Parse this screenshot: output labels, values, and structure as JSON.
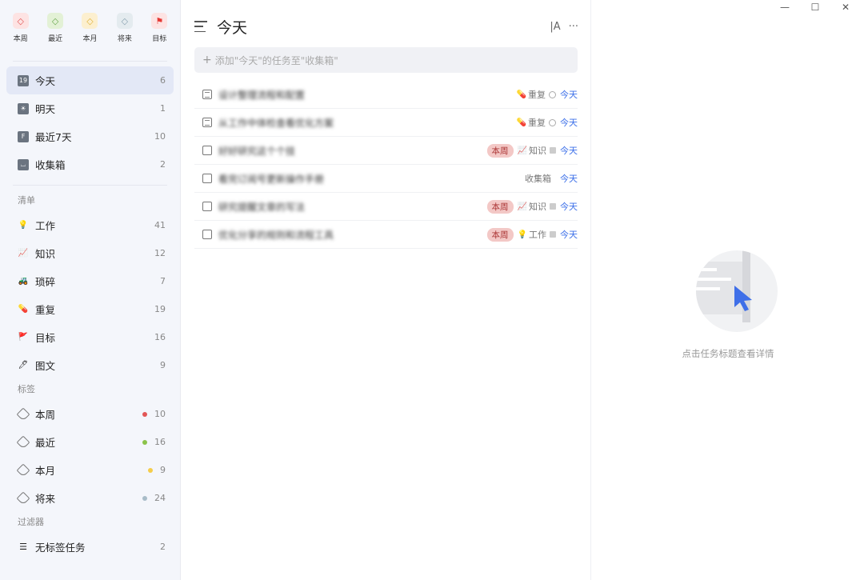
{
  "quick_filters": [
    {
      "label": "本周",
      "icon": "tag-red-icon",
      "bg": "#fde3e3",
      "color": "#e25656"
    },
    {
      "label": "最近",
      "icon": "tag-green-icon",
      "bg": "#e3f1d6",
      "color": "#6aa84f"
    },
    {
      "label": "本月",
      "icon": "tag-yellow-icon",
      "bg": "#fcefcf",
      "color": "#e0b33b"
    },
    {
      "label": "将来",
      "icon": "tag-gray-icon",
      "bg": "#e4ebef",
      "color": "#8aa2b1"
    },
    {
      "label": "目标",
      "icon": "flag-icon",
      "bg": "#fde3e3",
      "color": "#e53935"
    }
  ],
  "smart_lists": [
    {
      "label": "今天",
      "count": "6",
      "icon": "calendar-today-icon",
      "glyph": "19"
    },
    {
      "label": "明天",
      "count": "1",
      "icon": "sunrise-icon",
      "glyph": "☀"
    },
    {
      "label": "最近7天",
      "count": "10",
      "icon": "calendar-week-icon",
      "glyph": "F"
    },
    {
      "label": "收集箱",
      "count": "2",
      "icon": "inbox-icon",
      "glyph": "⌴"
    }
  ],
  "lists_title": "清单",
  "lists": [
    {
      "label": "工作",
      "count": "41",
      "icon": "lightbulb-icon",
      "glyph": "💡"
    },
    {
      "label": "知识",
      "count": "12",
      "icon": "knowledge-icon",
      "glyph": "📈"
    },
    {
      "label": "琐碎",
      "count": "7",
      "icon": "tractor-icon",
      "glyph": "🚜"
    },
    {
      "label": "重复",
      "count": "19",
      "icon": "pill-icon",
      "glyph": "💊"
    },
    {
      "label": "目标",
      "count": "16",
      "icon": "flag-icon",
      "glyph": "🚩"
    },
    {
      "label": "图文",
      "count": "9",
      "icon": "pen-icon",
      "glyph": "🖊"
    }
  ],
  "tags_title": "标签",
  "tags": [
    {
      "label": "本周",
      "count": "10",
      "color": "#e25656"
    },
    {
      "label": "最近",
      "count": "16",
      "color": "#8bc34a"
    },
    {
      "label": "本月",
      "count": "9",
      "color": "#f5cd4a"
    },
    {
      "label": "将来",
      "count": "24",
      "color": "#a8bcc8"
    }
  ],
  "filters_title": "过滤器",
  "filters": [
    {
      "label": "无标签任务",
      "count": "2"
    }
  ],
  "main": {
    "title": "今天",
    "sort_label": "|A",
    "more_label": "···",
    "add_placeholder": "添加\"今天\"的任务至\"收集箱\""
  },
  "tasks": [
    {
      "title": "设计整理流程和配置",
      "type": "note",
      "tag": "",
      "list": "重复",
      "list_glyph": "💊",
      "marker": "circle",
      "date": "今天"
    },
    {
      "title": "从工作中体检查看优化方案",
      "type": "note",
      "tag": "",
      "list": "重复",
      "list_glyph": "💊",
      "marker": "circle",
      "date": "今天"
    },
    {
      "title": "好好研究这个个技",
      "type": "check",
      "tag": "本周",
      "list": "知识",
      "list_glyph": "📈",
      "marker": "square",
      "date": "今天"
    },
    {
      "title": "看完订阅号更新操作手册",
      "type": "check",
      "tag": "",
      "list": "收集箱",
      "list_glyph": "",
      "marker": "none",
      "date": "今天"
    },
    {
      "title": "研究提醒文章的写法",
      "type": "check",
      "tag": "本周",
      "list": "知识",
      "list_glyph": "📈",
      "marker": "square",
      "date": "今天"
    },
    {
      "title": "优化分享的规则和流程工具",
      "type": "check",
      "tag": "本周",
      "list": "工作",
      "list_glyph": "💡",
      "marker": "square",
      "date": "今天"
    }
  ],
  "detail": {
    "empty_text": "点击任务标题查看详情"
  },
  "window": {
    "minimize": "—",
    "maximize": "☐",
    "close": "✕"
  }
}
